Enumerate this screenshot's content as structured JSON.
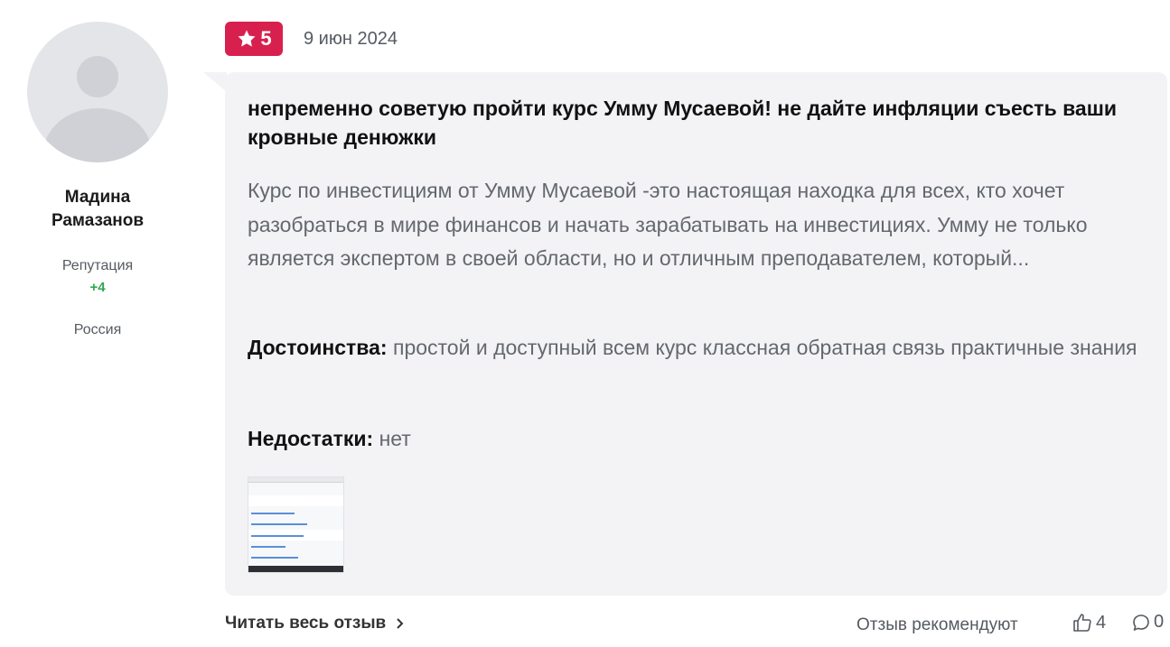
{
  "author": {
    "name_line1": "Мадина",
    "name_line2": "Рамазанов",
    "reputation_label": "Репутация",
    "reputation_value": "+4",
    "country": "Россия",
    "avatar_icon": "user-silhouette-icon"
  },
  "review": {
    "rating": "5",
    "rating_icon": "star-icon",
    "rating_color": "#d8204f",
    "date": "9 июн 2024",
    "title": "непременно советую пройти курс Умму Мусаевой! не дайте инфляции съесть ваши кровные денюжки",
    "text": "Курс по инвестициям от Умму Мусаевой -это настоящая находка для всех, кто хочет разобраться в мире финансов и начать зарабатывать на инвестициях. Умму не только является экспертом в своей области, но и отличным преподавателем, который...",
    "pros_label": "Достоинства:",
    "pros_text": "простой и доступный всем курс классная обратная связь практичные знания",
    "cons_label": "Недостатки:",
    "cons_text": "нет"
  },
  "footer": {
    "read_more": "Читать весь отзыв",
    "read_more_icon": "chevron-right-icon",
    "recommend": "Отзыв рекомендуют",
    "likes": "4",
    "likes_icon": "thumbs-up-icon",
    "comments": "0",
    "comments_icon": "comment-icon"
  }
}
